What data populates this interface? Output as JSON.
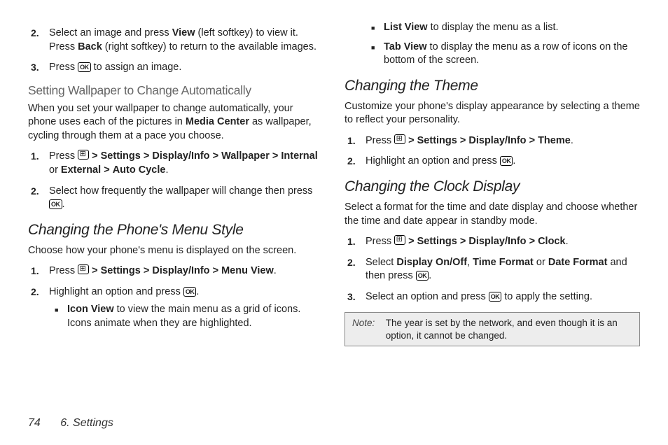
{
  "left": {
    "step2": {
      "pre": "Select an image and press ",
      "view": "View",
      "mid1": " (left softkey) to view it. Press ",
      "back": "Back",
      "post": " (right softkey) to return to the available images."
    },
    "step3": {
      "pre": "Press ",
      "ok": "OK",
      "post": " to assign an image."
    },
    "wall_h": "Setting Wallpaper to Change Automatically",
    "wall_p": {
      "pre": "When you set your wallpaper to change automatically, your phone uses each of the pictures in ",
      "mc": "Media Center",
      "post": " as wallpaper, cycling through them at a pace you choose."
    },
    "wall_s1": {
      "press": "Press ",
      "settings": "Settings",
      "display": "Display/Info",
      "wallpaper": "Wallpaper",
      "internal": "Internal",
      "or": " or ",
      "external": "External",
      "auto": "Auto Cycle"
    },
    "wall_s2": {
      "pre": "Select how frequently the wallpaper will change then press ",
      "ok": "OK",
      "post": "."
    },
    "menu_h": "Changing the Phone's Menu Style",
    "menu_p": "Choose how your phone's menu is displayed on the screen.",
    "menu_s1": {
      "press": "Press ",
      "settings": "Settings",
      "display": "Display/Info",
      "menuview": "Menu View"
    },
    "menu_s2": {
      "pre": "Highlight an option and press ",
      "ok": "OK",
      "post": "."
    },
    "iconview": {
      "label": "Icon View",
      "text": " to view the main menu as a grid of icons. Icons animate when they are highlighted."
    }
  },
  "right": {
    "listview": {
      "label": "List View",
      "text": " to display the menu as a list."
    },
    "tabview": {
      "label": "Tab View",
      "text": " to display the menu as a row of icons on the bottom of the screen."
    },
    "theme_h": "Changing the Theme",
    "theme_p": "Customize your phone's display appearance by selecting a theme to reflect your personality.",
    "theme_s1": {
      "press": "Press ",
      "settings": "Settings",
      "display": "Display/Info",
      "theme": "Theme"
    },
    "theme_s2": {
      "pre": "Highlight an option and press ",
      "ok": "OK",
      "post": "."
    },
    "clock_h": "Changing the Clock Display",
    "clock_p": "Select a format for the time and date display and choose whether the time and date appear in standby mode.",
    "clock_s1": {
      "press": "Press ",
      "settings": "Settings",
      "display": "Display/Info",
      "clock": "Clock"
    },
    "clock_s2": {
      "pre": "Select ",
      "d1": "Display On/Off",
      "c": ", ",
      "d2": "Time Format",
      "or": " or ",
      "d3": "Date Format",
      "post": " and then press ",
      "ok": "OK",
      "end": "."
    },
    "clock_s3": {
      "pre": "Select an option and press ",
      "ok": "OK",
      "post": " to apply the setting."
    },
    "note_label": "Note:",
    "note_text": "The year is set by the network, and even though it is an option, it cannot be changed."
  },
  "footer": {
    "page": "74",
    "section": "6. Settings"
  },
  "gt": ">",
  "markers": {
    "m1": "1.",
    "m2": "2.",
    "m3": "3."
  }
}
